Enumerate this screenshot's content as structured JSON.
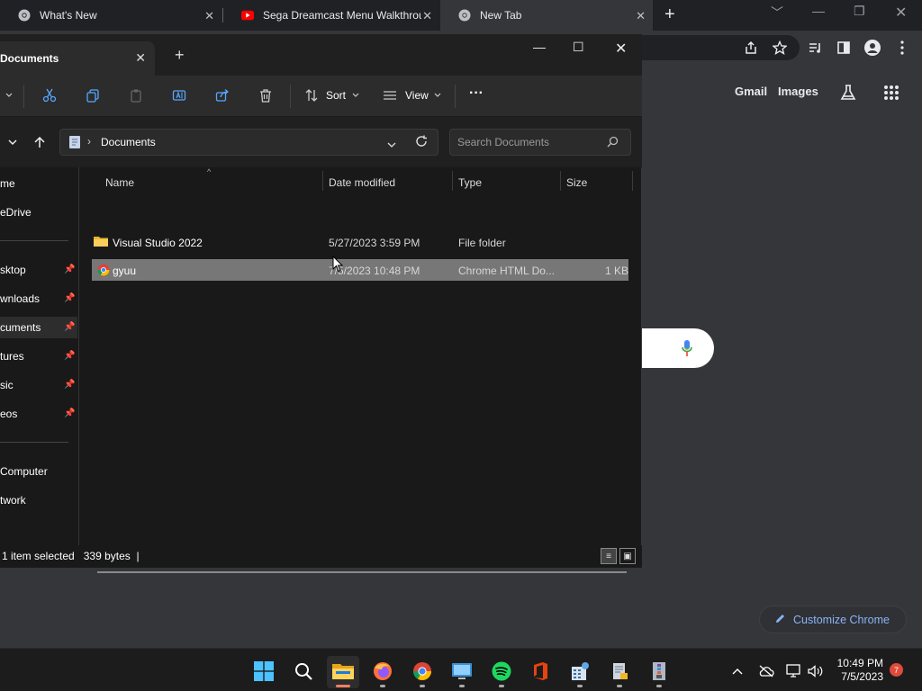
{
  "chrome": {
    "tabs": [
      {
        "title": "What's New"
      },
      {
        "title": "Sega Dreamcast Menu Walkthrough"
      },
      {
        "title": "New Tab"
      }
    ],
    "new_tab_symbol": "+",
    "ntp_links": {
      "gmail": "Gmail",
      "images": "Images"
    },
    "customize_label": "Customize Chrome"
  },
  "explorer": {
    "tab_title": "Documents",
    "toolbar": {
      "sort_label": "Sort",
      "view_label": "View",
      "more_label": "···"
    },
    "address": {
      "path": "Documents"
    },
    "search": {
      "placeholder": "Search Documents"
    },
    "nav": [
      {
        "label": "me"
      },
      {
        "label": "eDrive"
      },
      {
        "label": "sktop",
        "pinned": true
      },
      {
        "label": "wnloads",
        "pinned": true
      },
      {
        "label": "cuments",
        "pinned": true,
        "selected": true
      },
      {
        "label": "tures",
        "pinned": true
      },
      {
        "label": "sic",
        "pinned": true
      },
      {
        "label": "eos",
        "pinned": true
      },
      {
        "label": "Computer"
      },
      {
        "label": "twork"
      }
    ],
    "columns": {
      "name": "Name",
      "date": "Date modified",
      "type": "Type",
      "size": "Size"
    },
    "files": [
      {
        "name": "Visual Studio 2022",
        "date": "5/27/2023 3:59 PM",
        "type": "File folder",
        "size": "",
        "icon": "folder-icon"
      },
      {
        "name": "gyuu",
        "date": "7/5/2023 10:48 PM",
        "type": "Chrome HTML Do...",
        "size": "1 KB",
        "icon": "chrome-icon",
        "selected": true
      }
    ],
    "status": {
      "selection": "1 item selected",
      "bytes": "339 bytes"
    }
  },
  "taskbar": {
    "time": "10:49 PM",
    "date": "7/5/2023",
    "notification_count": "7"
  }
}
